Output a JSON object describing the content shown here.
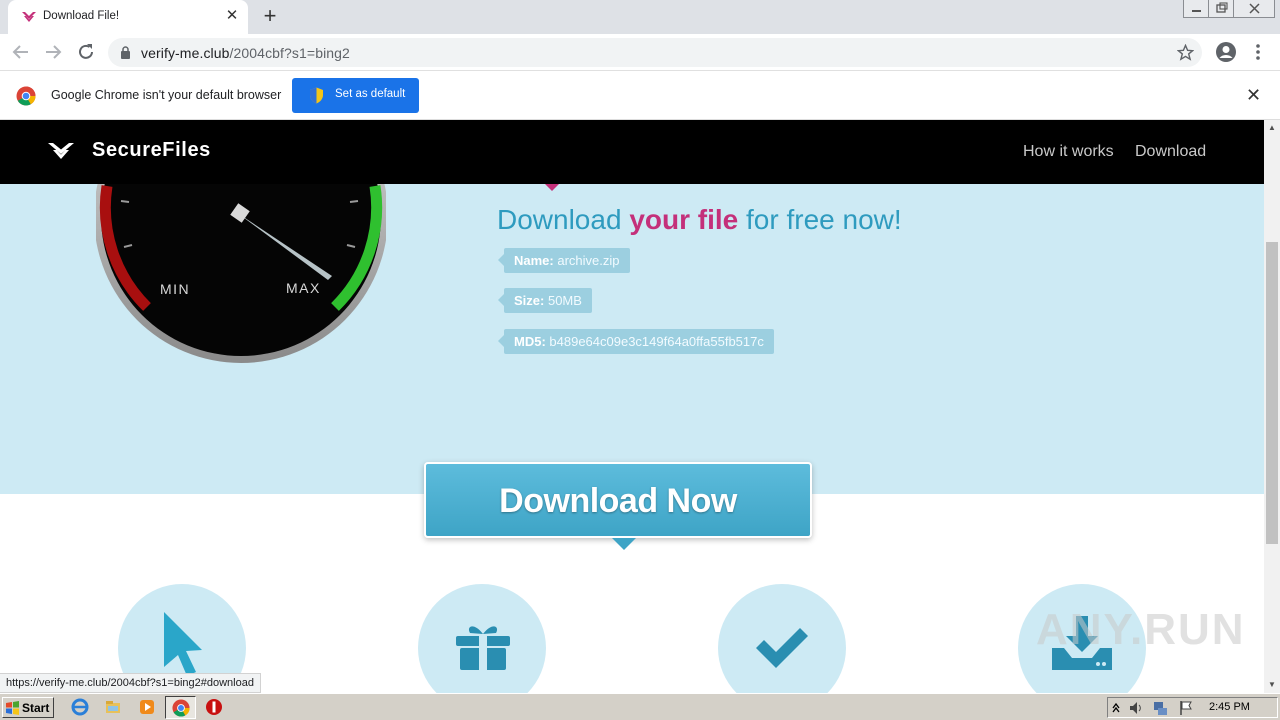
{
  "browser": {
    "tab_title": "Download File!",
    "new_tab_glyph": "+",
    "close_glyph": "✕",
    "url_host": "verify-me.club",
    "url_path": "/2004cbf?s1=bing2",
    "status_url": "https://verify-me.club/2004cbf?s1=bing2#download"
  },
  "infobar": {
    "message": "Google Chrome isn't your default browser",
    "button_label": "Set as default",
    "close_glyph": "✕"
  },
  "site": {
    "brand": "SecureFiles",
    "nav": [
      "How it works",
      "Download"
    ],
    "headline_parts": [
      "Download ",
      "your file",
      " for free now!"
    ],
    "gauge": {
      "min_label": "MIN",
      "max_label": "MAX"
    },
    "file_info": [
      {
        "label": "Name:",
        "value": "archive.zip"
      },
      {
        "label": "Size:",
        "value": "50MB"
      },
      {
        "label": "MD5:",
        "value": "b489e64c09e3c149f64a0ffa55fb517c"
      }
    ],
    "cta_label": "Download Now",
    "features": [
      "cursor-icon",
      "gift-icon",
      "checkmark-icon",
      "download-tray-icon"
    ],
    "colors": {
      "hero_bg": "#cdeaf4",
      "accent_blue": "#2e9bbf",
      "accent_pink": "#c4307a",
      "button": "#4fb3d6"
    }
  },
  "watermark": "ANY.RUN",
  "taskbar": {
    "start_label": "Start",
    "clock": "2:45 PM"
  }
}
